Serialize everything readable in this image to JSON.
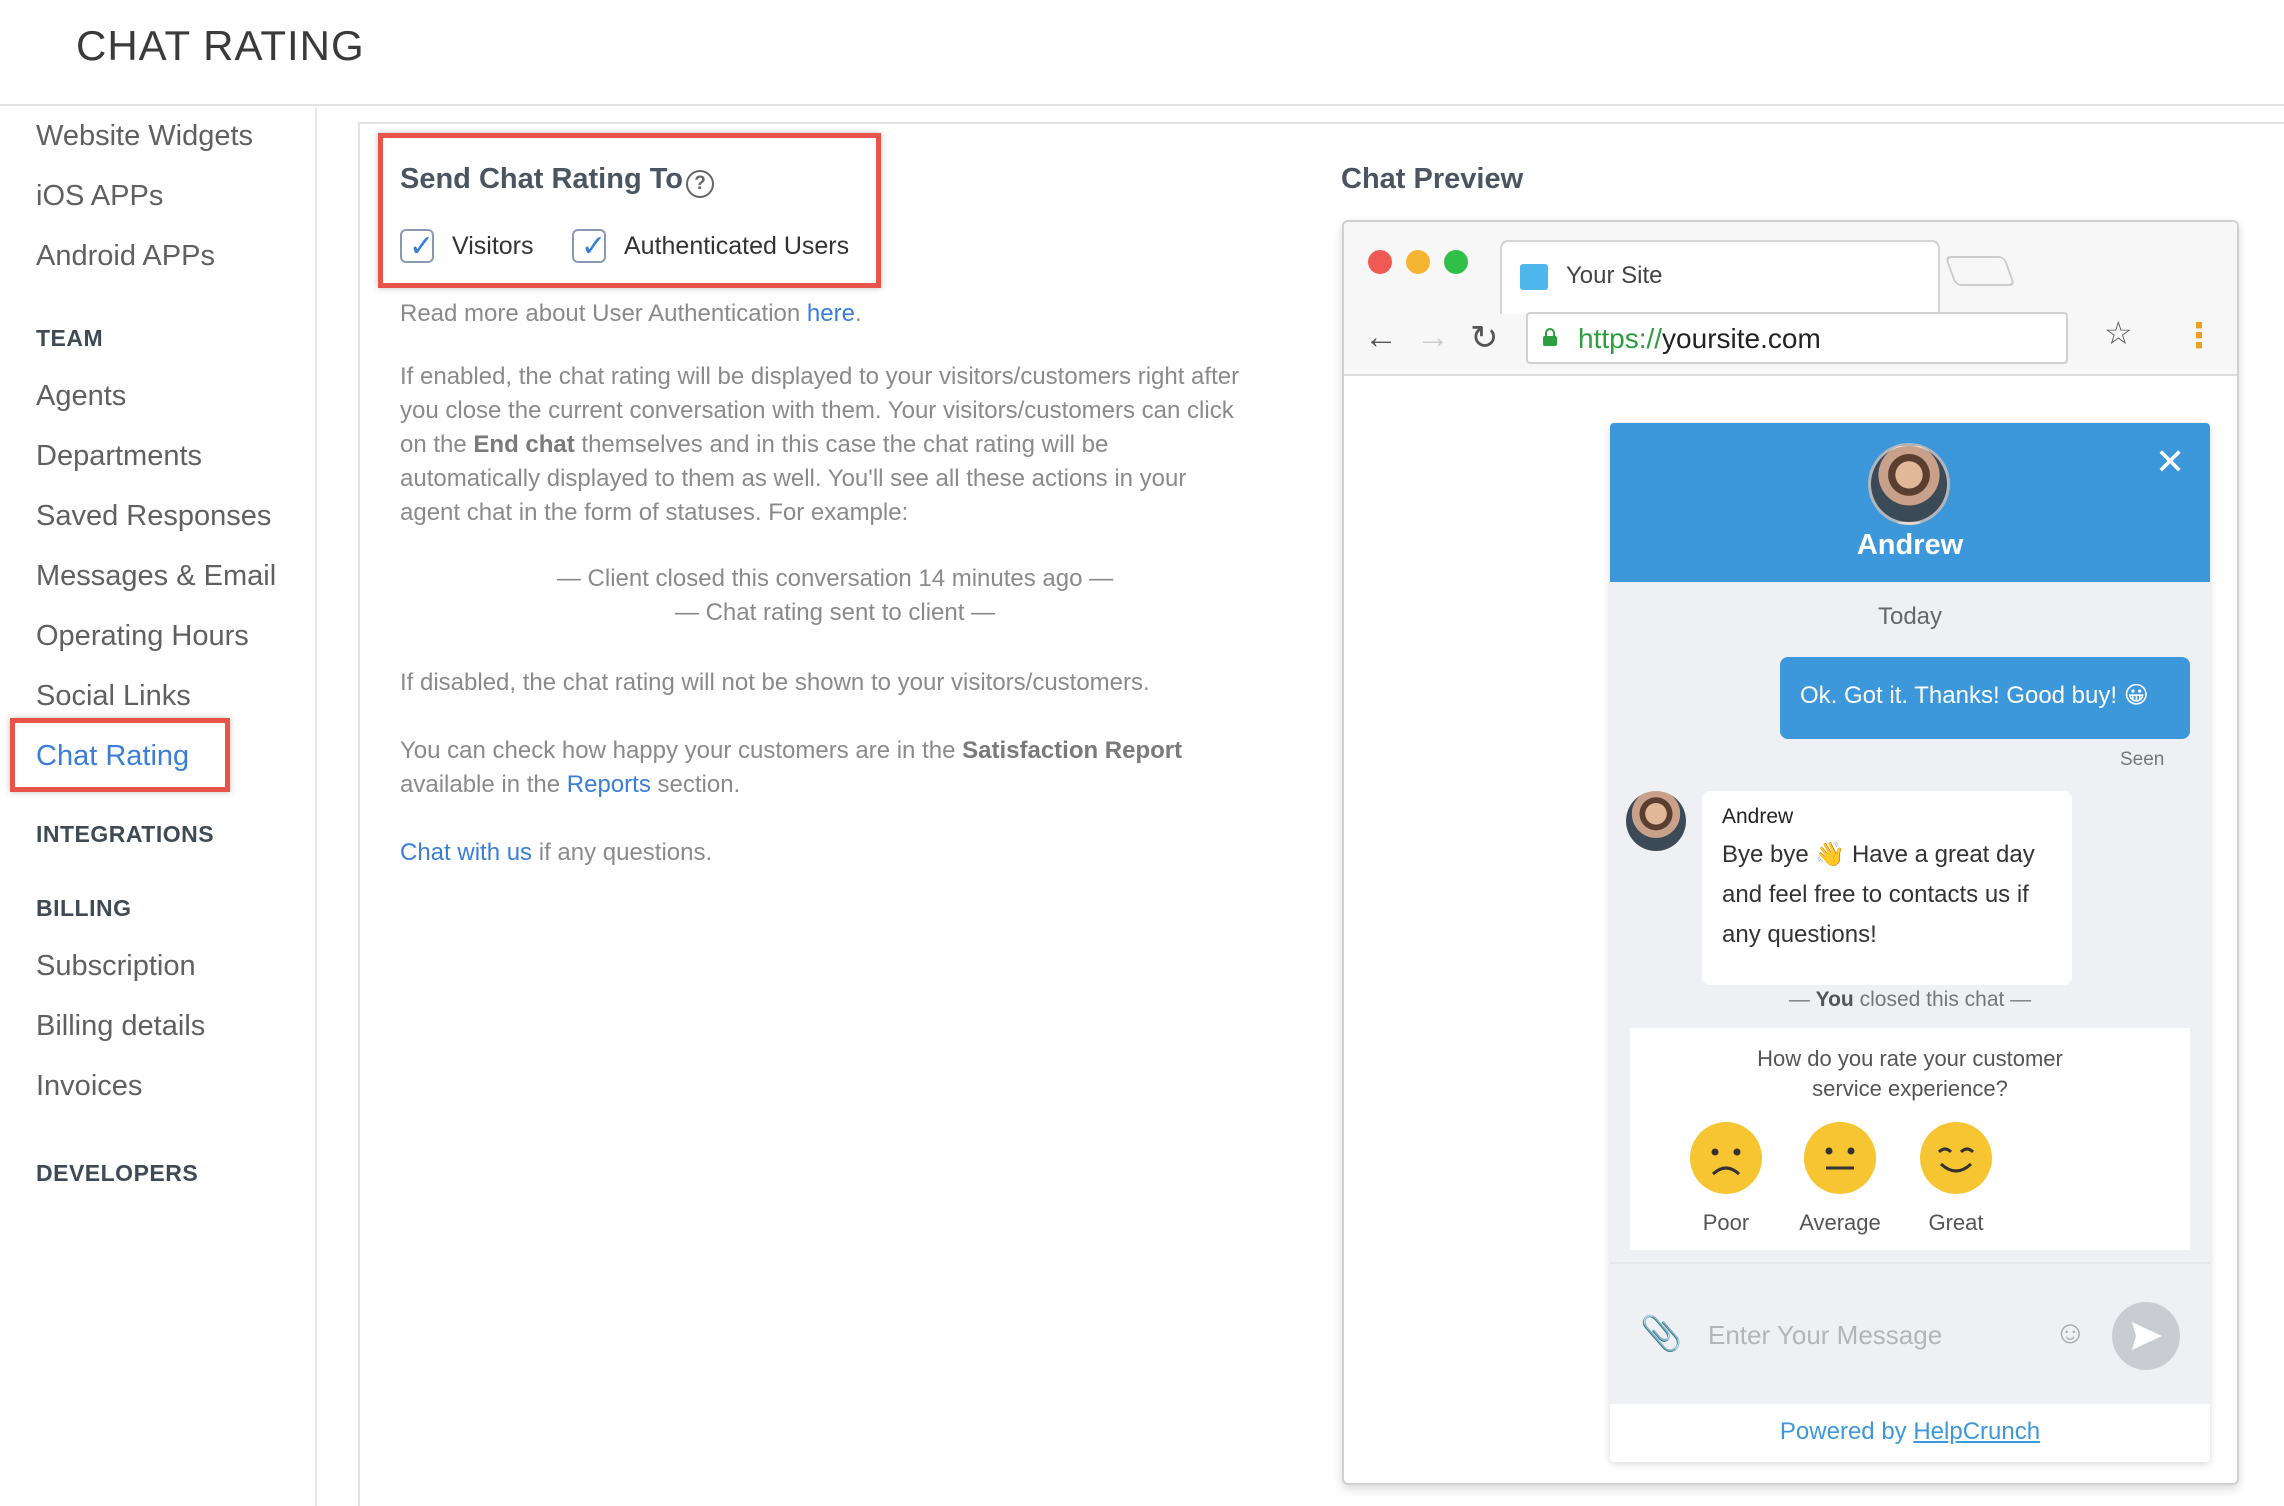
{
  "header": {
    "title": "CHAT RATING"
  },
  "sidebar": {
    "links_top": [
      "Website Widgets",
      "iOS APPs",
      "Android APPs"
    ],
    "team_section": "TEAM",
    "team_links": [
      "Agents",
      "Departments",
      "Saved Responses",
      "Messages & Email",
      "Operating Hours",
      "Social Links",
      "Chat Rating"
    ],
    "integrations_section": "INTEGRATIONS",
    "billing_section": "BILLING",
    "billing_links": [
      "Subscription",
      "Billing details",
      "Invoices"
    ],
    "developers_section": "DEVELOPERS",
    "active_item": "Chat Rating"
  },
  "settings": {
    "title": "Send Chat Rating To",
    "help_glyph": "?",
    "visitors_label": "Visitors",
    "visitors_checked": true,
    "auth_label": "Authenticated Users",
    "auth_checked": true,
    "read_more_prefix": "Read more about User Authentication ",
    "read_more_link": "here",
    "read_more_suffix": ".",
    "para1_a": "If enabled, the chat rating will be displayed to your visitors/customers right after you close the current conversation with them. Your visitors/customers can click on the ",
    "para1_bold": "End chat",
    "para1_b": " themselves and in this case the chat rating will be automatically displayed to them as well. You'll see all these actions in your agent chat in the form of statuses. For example:",
    "example1": "— Client closed this conversation 14 minutes ago —",
    "example2": "— Chat rating sent to client —",
    "para2": "If disabled, the chat rating will not be shown to your visitors/customers.",
    "para3_a": "You can check how happy your customers are in the ",
    "para3_bold": "Satisfaction Report",
    "para3_b": " available in the ",
    "para3_link": "Reports",
    "para3_c": " section.",
    "chat_link": "Chat with us",
    "chat_suffix": " if any questions."
  },
  "preview": {
    "title": "Chat Preview",
    "tab_title": "Your Site",
    "url_proto": "https://",
    "url_host": "yoursite.com",
    "widget": {
      "agent_name": "Andrew",
      "day_label": "Today",
      "outgoing_message": "Ok. Got it. Thanks! Good buy! 😀",
      "seen_label": "Seen",
      "incoming_sender": "Andrew",
      "incoming_message": "Bye bye 👋 Have a great day and feel free to contacts us if any questions!",
      "closed_prefix": "— ",
      "closed_bold": "You",
      "closed_suffix": " closed this chat —",
      "rating_question": "How do you rate your customer service experience?",
      "rating_options": [
        "Poor",
        "Average",
        "Great"
      ],
      "input_placeholder": "Enter Your Message",
      "powered_prefix": "Powered by ",
      "powered_link": "HelpCrunch"
    }
  },
  "colors": {
    "accent": "#3b7ed8",
    "widget_blue": "#3d97db",
    "highlight_red": "#e8534a",
    "face_yellow": "#f7c531"
  }
}
